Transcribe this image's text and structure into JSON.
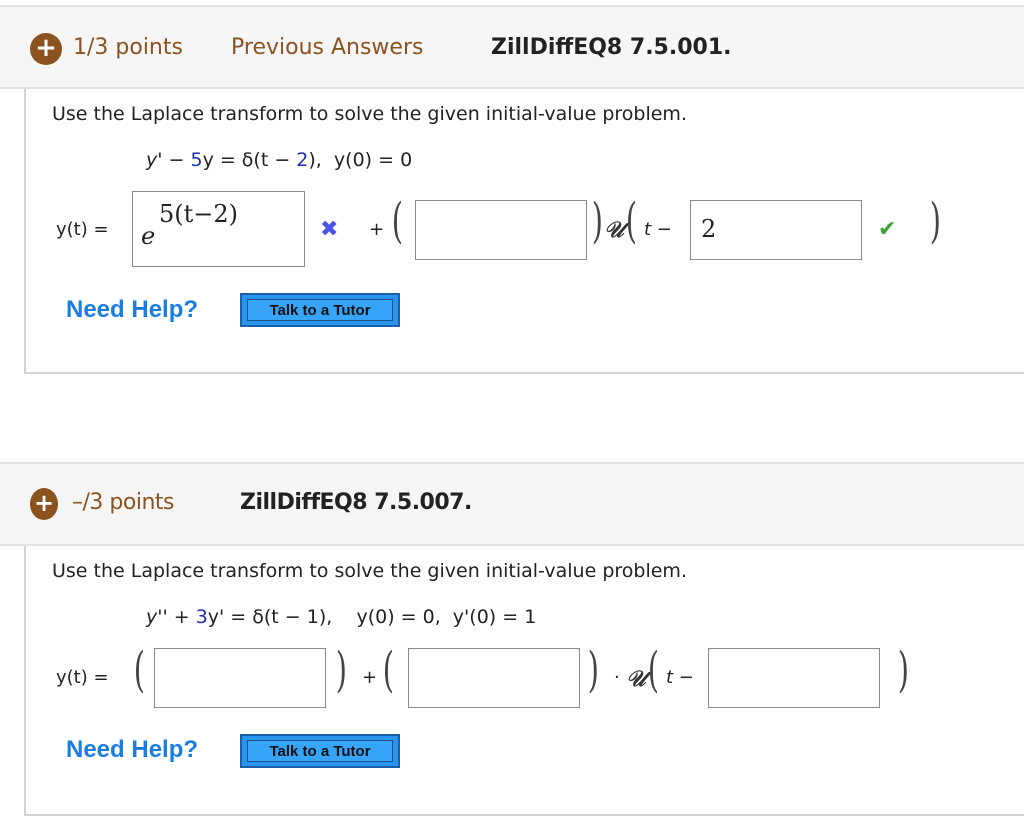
{
  "questions": [
    {
      "points": "1/3 points",
      "previous_answers": "Previous Answers",
      "id": "ZillDiffEQ8 7.5.001.",
      "prompt": "Use the Laplace transform to solve the given initial-value problem.",
      "equation": {
        "p1": "y' − ",
        "coef": "5",
        "p2": "y = δ(t − ",
        "coef2": "2",
        "p3": "),  y(0) = 0"
      },
      "lhs": "y(t) =",
      "answers": [
        {
          "value_base": "e",
          "value_exp": "5(t−2)",
          "status": "incorrect"
        },
        {
          "value": "",
          "status": "none"
        },
        {
          "value": "2",
          "status": "correct"
        }
      ],
      "plus": "+",
      "heaviside": "𝒰",
      "t_minus": "t −",
      "need_help": "Need Help?",
      "tutor_button": "Talk to a Tutor"
    },
    {
      "points": "–/3 points",
      "id": "ZillDiffEQ8 7.5.007.",
      "prompt": "Use the Laplace transform to solve the given initial-value problem.",
      "equation": {
        "p1": "y'' + ",
        "coef": "3",
        "p2": "y' = δ(t − 1),    y(0) = 0,  y'(0) = 1"
      },
      "lhs": "y(t) =",
      "answers": [
        {
          "value": ""
        },
        {
          "value": ""
        },
        {
          "value": ""
        }
      ],
      "plus": "+",
      "dot": "·",
      "heaviside": "𝒰",
      "t_minus": "t −",
      "need_help": "Need Help?",
      "tutor_button": "Talk to a Tutor"
    }
  ],
  "icons": {
    "expand": "+",
    "incorrect": "✖",
    "correct": "✔"
  },
  "colors": {
    "points_brown": "#8b5320",
    "coef_blue": "#1f2fa8",
    "help_blue": "#1a7ee0",
    "incorrect_blue": "#4a55e8",
    "correct_green": "#3aa33a"
  }
}
